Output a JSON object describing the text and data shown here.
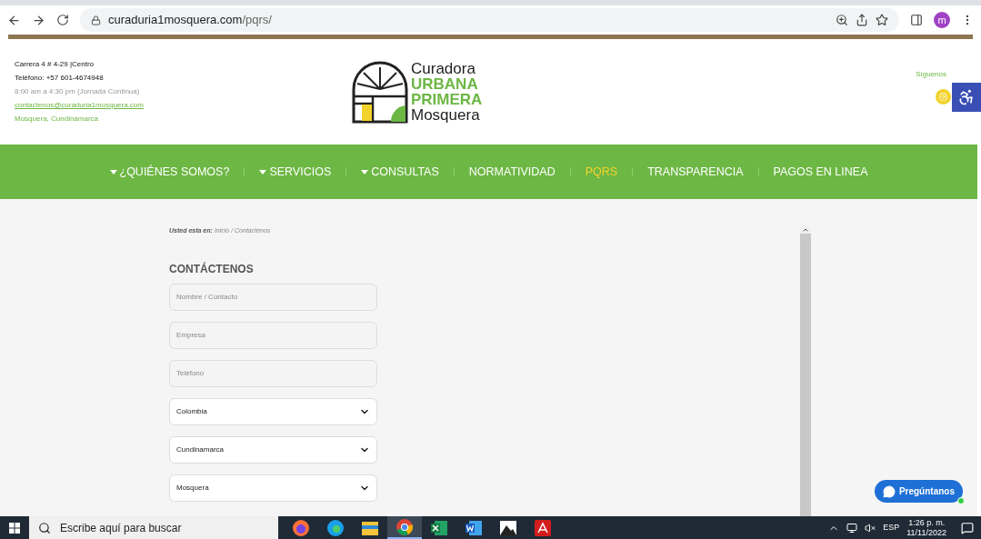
{
  "browser": {
    "url_host": "curaduria1mosquera.com",
    "url_path": "/pqrs/",
    "profile_initial": "m"
  },
  "header": {
    "contact": [
      {
        "kind": "plain",
        "text": "Carrera 4 # 4-29 |Centro"
      },
      {
        "kind": "plain",
        "text": "Teléfono: +57 601-4674948"
      },
      {
        "kind": "muted",
        "text": "8:00 am a 4:30 pm (Jornada Continua)"
      },
      {
        "kind": "link",
        "text": "contactenos@curaduria1mosquera.com"
      },
      {
        "kind": "accent",
        "text": "Mosquera, Cundinamarca"
      }
    ],
    "logo": {
      "line_1": "Curadora",
      "line_2": "URBANA",
      "line_3": "PRIMERA",
      "line_4": "Mosquera"
    },
    "social_label": "Síguenos"
  },
  "nav": [
    {
      "label": "¿QUIÉNES SOMOS?",
      "dropdown": true,
      "selected": false
    },
    {
      "label": "SERVICIOS",
      "dropdown": true,
      "selected": false
    },
    {
      "label": "CONSULTAS",
      "dropdown": true,
      "selected": false
    },
    {
      "label": "NORMATIVIDAD",
      "dropdown": false,
      "selected": false
    },
    {
      "label": "PQRS",
      "dropdown": false,
      "selected": true
    },
    {
      "label": "TRANSPARENCIA",
      "dropdown": false,
      "selected": false
    },
    {
      "label": "PAGOS EN LINEA",
      "dropdown": false,
      "selected": false
    }
  ],
  "breadcrumb": {
    "prefix": "Usted esta en:",
    "path": "Inicio / Contáctenos"
  },
  "form": {
    "title": "CONTÁCTENOS",
    "fields": [
      {
        "kind": "input",
        "placeholder": "Nombre / Contacto"
      },
      {
        "kind": "input",
        "placeholder": "Empresa"
      },
      {
        "kind": "input",
        "placeholder": "Teléfono"
      },
      {
        "kind": "select",
        "value": "Colombia"
      },
      {
        "kind": "select",
        "value": "Cundinamarca"
      },
      {
        "kind": "select",
        "value": "Mosquera"
      }
    ]
  },
  "chat_button": {
    "label": "Pregúntanos"
  },
  "taskbar": {
    "search_placeholder": "Escribe aquí para buscar",
    "apps": [
      {
        "kind": "firefox",
        "selected": false
      },
      {
        "kind": "edge",
        "selected": false
      },
      {
        "kind": "folder",
        "selected": false
      },
      {
        "kind": "chrome",
        "selected": true
      },
      {
        "kind": "excel",
        "selected": false
      },
      {
        "kind": "word",
        "selected": false
      },
      {
        "kind": "photos",
        "selected": false
      },
      {
        "kind": "acrobat",
        "selected": false
      }
    ],
    "language": "ESP",
    "time": "1:26 p. m.",
    "date": "11/11/2022"
  }
}
